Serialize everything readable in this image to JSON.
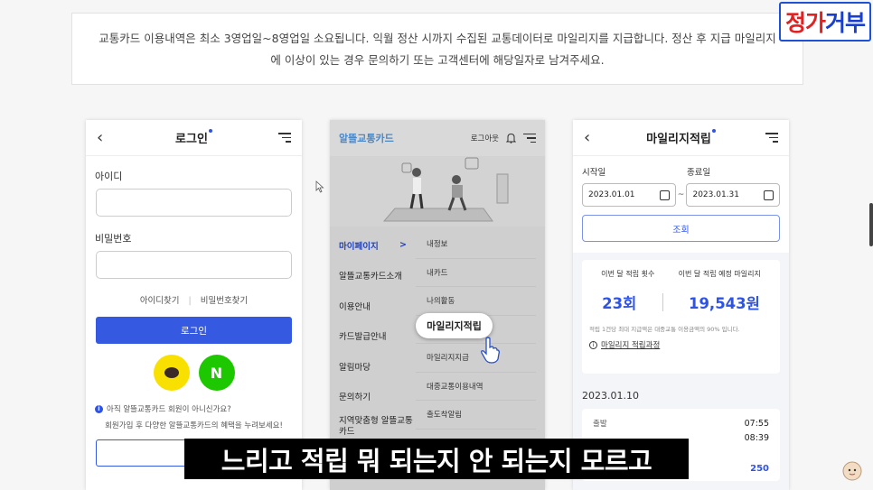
{
  "notice": {
    "line1": "교통카드 이용내역은 최소 3영업일~8영업일 소요됩니다. 익월 정산 시까지 수집된 교통데이터로 마일리지를 지급합니다. 정산 후 지급 마일리지",
    "line2": "에 이상이 있는 경우 문의하기 또는 고객센터에 해당일자로 남겨주세요."
  },
  "watermark": {
    "part1": "정가",
    "part2": "거부"
  },
  "login": {
    "title": "로그인",
    "id_label": "아이디",
    "pw_label": "비밀번호",
    "find_id": "아이디찾기",
    "link_sep": "|",
    "find_pw": "비밀번호찾기",
    "login_button": "로그인",
    "naver_letter": "N",
    "join_question": "아직 알뜰교통카드 회원이 아니신가요?",
    "join_desc": "회원가입 후 다양한 알뜰교통카드의 혜택을 누려보세요!",
    "join_button_partial": "회"
  },
  "menu": {
    "logo": "알뜰교통카드",
    "logout": "로그아웃",
    "left_items": [
      "마이페이지",
      "알뜰교통카드소개",
      "이용안내",
      "카드발급안내",
      "알림마당",
      "문의하기",
      "지역맞춤형 알뜰교통카드"
    ],
    "active_arrow": ">",
    "right_items": [
      "내정보",
      "내카드",
      "나의활동",
      "",
      "마일리지지급",
      "대중교통이용내역",
      "출도착알림"
    ],
    "popup_label": "마일리지적립"
  },
  "mileage": {
    "title": "마일리지적립",
    "start_label": "시작일",
    "end_label": "종료일",
    "start_date": "2023.01.01",
    "end_date": "2023.01.31",
    "tilde": "~",
    "search_button": "조회",
    "count_label": "이번 달 적립 횟수",
    "amount_label": "이번 달 적립 예정 마일리지",
    "count_value": "23회",
    "amount_value": "19,543원",
    "note": "적립 1건당 최대 지급액은 대중교통 이용금액의 90% 입니다.",
    "process_link": "마일리지 적립과정",
    "list_date": "2023.01.10",
    "ride": {
      "depart_label": "출발",
      "depart_time": "07:55",
      "arrive_time": "08:39",
      "points": "250"
    }
  },
  "subtitle": "느리고 적립 뭐 되는지 안 되는지 모르고",
  "colors": {
    "accent": "#2e54e6",
    "kakao": "#f8e000",
    "naver": "#1ec800"
  }
}
